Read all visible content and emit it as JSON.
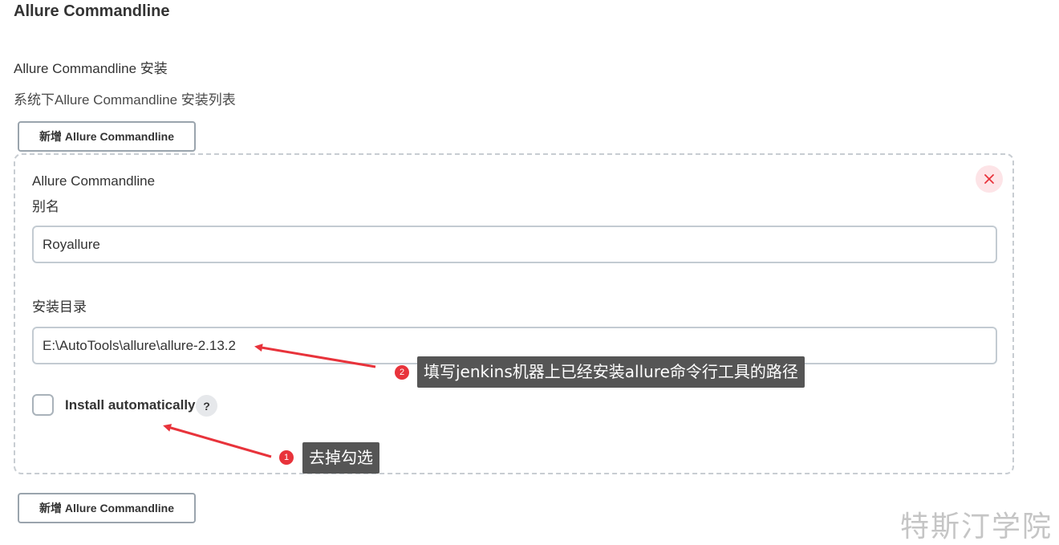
{
  "section": {
    "title": "Allure Commandline",
    "installations_label": "Allure Commandline 安装",
    "installations_description": "系统下Allure Commandline 安装列表",
    "add_button_label": "新增 Allure Commandline",
    "add_button_bottom_label": "新增 Allure Commandline"
  },
  "installation": {
    "heading": "Allure Commandline",
    "alias_label": "别名",
    "alias_value": "Royallure",
    "home_label": "安装目录",
    "home_value": "E:\\AutoTools\\allure\\allure-2.13.2",
    "delete_icon": "close-icon",
    "install_auto_label": "Install automatically",
    "install_auto_checked": false,
    "help_glyph": "?"
  },
  "annotations": [
    {
      "number": "2",
      "text": "填写jenkins机器上已经安装allure命令行工具的路径"
    },
    {
      "number": "1",
      "text": "去掉勾选"
    }
  ],
  "colors": {
    "annotation_arrow": "#e8333b",
    "annotation_bg": "#555555",
    "delete_bg": "#fde4e7",
    "delete_icon": "#e8333b"
  },
  "watermark": "特斯汀学院"
}
